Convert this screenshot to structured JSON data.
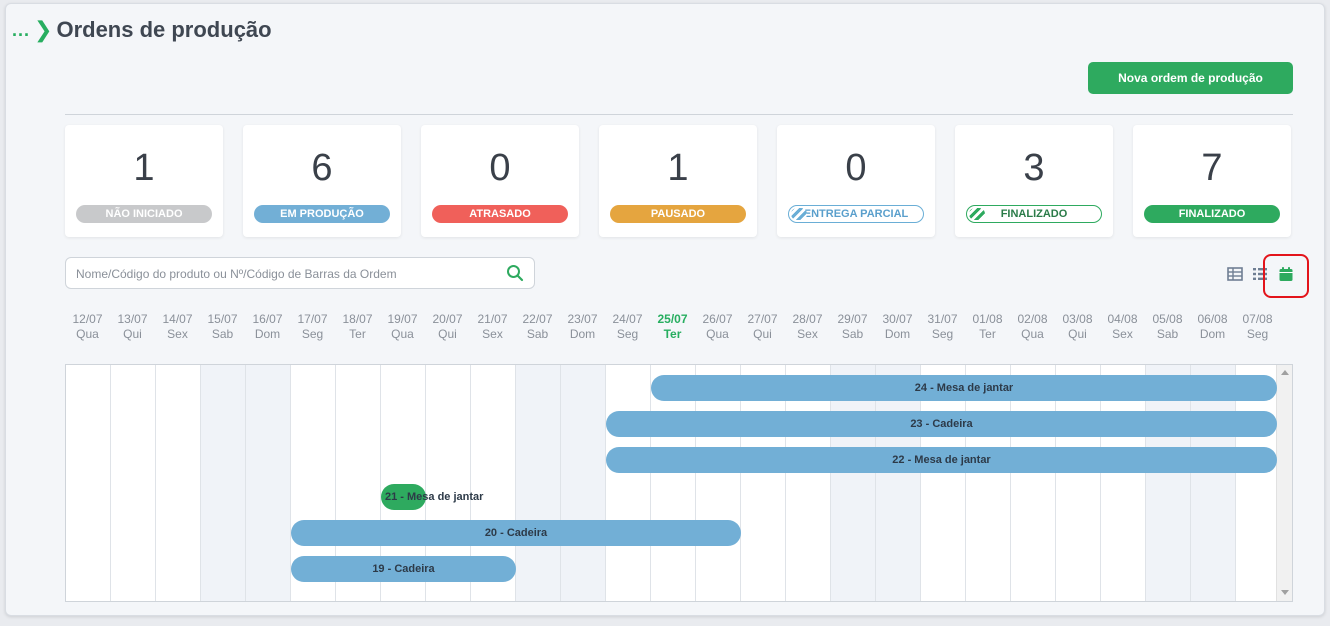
{
  "breadcrumb": {
    "dots": "...",
    "title": "Ordens de produção"
  },
  "toolbar": {
    "new_order_label": "Nova ordem de produção"
  },
  "status_cards": [
    {
      "count": "1",
      "label": "NÃO INICIADO",
      "color": "#c8c9cb",
      "style": "solid"
    },
    {
      "count": "6",
      "label": "EM PRODUÇÃO",
      "color": "#72afd6",
      "style": "solid"
    },
    {
      "count": "0",
      "label": "ATRASADO",
      "color": "#f0605a",
      "style": "solid"
    },
    {
      "count": "1",
      "label": "PAUSADO",
      "color": "#e5a53f",
      "style": "solid"
    },
    {
      "count": "0",
      "label": "ENTREGA PARCIAL",
      "color": "#72afd6",
      "style": "outline-blue"
    },
    {
      "count": "3",
      "label": "FINALIZADO",
      "color": "#2eaa5f",
      "style": "outline-green"
    },
    {
      "count": "7",
      "label": "FINALIZADO",
      "color": "#2eaa5f",
      "style": "solid"
    }
  ],
  "search": {
    "placeholder": "Nome/Código do produto ou Nº/Código de Barras da Ordem",
    "value": ""
  },
  "view_icons": [
    "table-view-icon",
    "list-view-icon",
    "calendar-view-icon"
  ],
  "timeline": {
    "days": [
      {
        "date": "12/07",
        "weekday": "Qua"
      },
      {
        "date": "13/07",
        "weekday": "Qui"
      },
      {
        "date": "14/07",
        "weekday": "Sex"
      },
      {
        "date": "15/07",
        "weekday": "Sab"
      },
      {
        "date": "16/07",
        "weekday": "Dom"
      },
      {
        "date": "17/07",
        "weekday": "Seg"
      },
      {
        "date": "18/07",
        "weekday": "Ter"
      },
      {
        "date": "19/07",
        "weekday": "Qua"
      },
      {
        "date": "20/07",
        "weekday": "Qui"
      },
      {
        "date": "21/07",
        "weekday": "Sex"
      },
      {
        "date": "22/07",
        "weekday": "Sab"
      },
      {
        "date": "23/07",
        "weekday": "Dom"
      },
      {
        "date": "24/07",
        "weekday": "Seg"
      },
      {
        "date": "25/07",
        "weekday": "Ter"
      },
      {
        "date": "26/07",
        "weekday": "Qua"
      },
      {
        "date": "27/07",
        "weekday": "Qui"
      },
      {
        "date": "28/07",
        "weekday": "Sex"
      },
      {
        "date": "29/07",
        "weekday": "Sab"
      },
      {
        "date": "30/07",
        "weekday": "Dom"
      },
      {
        "date": "31/07",
        "weekday": "Seg"
      },
      {
        "date": "01/08",
        "weekday": "Ter"
      },
      {
        "date": "02/08",
        "weekday": "Qua"
      },
      {
        "date": "03/08",
        "weekday": "Qui"
      },
      {
        "date": "04/08",
        "weekday": "Sex"
      },
      {
        "date": "05/08",
        "weekday": "Sab"
      },
      {
        "date": "06/08",
        "weekday": "Dom"
      },
      {
        "date": "07/08",
        "weekday": "Seg"
      }
    ],
    "today": "25/07",
    "orders": [
      {
        "label": "24 - Mesa de jantar",
        "start": "25/07",
        "end": "07/08",
        "color": "#72afd6"
      },
      {
        "label": "23 - Cadeira",
        "start": "24/07",
        "end": "07/08",
        "color": "#72afd6"
      },
      {
        "label": "22 - Mesa de jantar",
        "start": "24/07",
        "end": "07/08",
        "color": "#72afd6"
      },
      {
        "label": "21 - Mesa de jantar",
        "start": "19/07",
        "end": "19/07",
        "color": "#2eaa5f"
      },
      {
        "label": "20 - Cadeira",
        "start": "17/07",
        "end": "26/07",
        "color": "#72afd6"
      },
      {
        "label": "19 - Cadeira",
        "start": "17/07",
        "end": "21/07",
        "color": "#72afd6"
      }
    ]
  }
}
